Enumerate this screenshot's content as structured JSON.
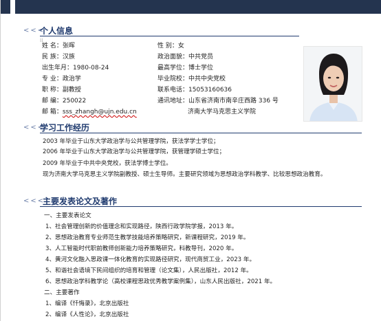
{
  "sections": {
    "personal": {
      "chevron": "<<<",
      "title": "个人信息"
    },
    "experience": {
      "chevron": "<<<",
      "title": "学习工作经历"
    },
    "papers": {
      "chevron": "<<<",
      "title": "主要发表论文及著作"
    }
  },
  "personal": {
    "name_label": "姓      名：",
    "name": "张晖",
    "gender_label": "性      别：",
    "gender": "女",
    "ethnicity_label": "民      族：",
    "ethnicity": "汉族",
    "party_label": "政治面貌：",
    "party": "中共党员",
    "birth_label": "出生年月：",
    "birth": "1980-08-24",
    "degree_label": "最高学位：",
    "degree": "博士学位",
    "major_label": "专      业：",
    "major": "政治学",
    "school_label": "毕业院校：",
    "school": "中共中央党校",
    "title_label": "职      称：",
    "title": "副教授",
    "phone_label": "联系电话：",
    "phone": "15053160636",
    "postcode_label": "邮      编：",
    "postcode": "250022",
    "address_label": "通讯地址：",
    "address_line1": "山东省济南市南辛庄西路 336 号",
    "address_line2": "济南大学马克思主义学院",
    "email_label": "邮      箱：",
    "email": "sss_zhangh@ujn.edu.cn"
  },
  "experience": [
    "2003 年毕业于山东大学政治学与公共管理学院，获法学学士学位；",
    "2006 年毕业于山东大学政治学与公共管理学院，获管理学硕士学位；",
    "2009 年毕业于中共中央党校，获法学博士学位。",
    "现为济南大学马克思主义学院副教授、硕士生导师。主要研究领域为思想政治学科教学、比较思想政治教育。"
  ],
  "papers": {
    "sub1": "一、主要发表论文",
    "items": [
      "1、社会管理创新的价值理念和实现路径，陕西行政学院学报，2013 年。",
      "2、思想政治教育专业师范生教学技能培养策略研究，新课程研究，2019 年。",
      "3、人工智能时代职前教师创新能力培养策略研究，科教导刊，2020 年。",
      "4、黄河文化融入思政课一体化教育的实现路径研究，现代商贸工业，2023 年。",
      "5、和谐社会语境下民间组织的培育和管理（论文集），人民出版社，2012 年。",
      "6、思想政治学科教学论（高校课程思政优秀教学案例集），山东人民出版社，2021 年。"
    ],
    "sub2": "二、主要著作",
    "books": [
      "1、编译《忏悔录》，北京出版社",
      "2、编译《人性论》，北京出版社"
    ]
  }
}
